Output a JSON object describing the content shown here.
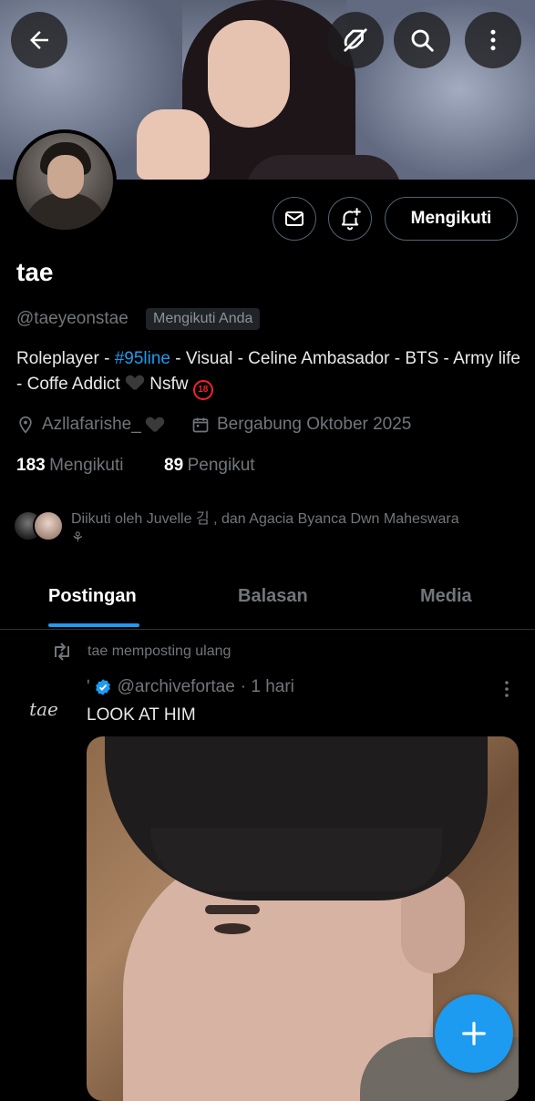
{
  "header": {
    "back_icon": "arrow-left-icon",
    "icons": [
      "tag-off-icon",
      "search-icon",
      "more-vertical-icon"
    ]
  },
  "profile": {
    "name": "tae",
    "handle": "@taeyeonstae",
    "follows_you": "Mengikuti Anda",
    "follow_button": "Mengikuti",
    "bio": {
      "part1": "Roleplayer - ",
      "hashtag": "#95line",
      "part2": " - Visual -  Celine Ambasador - BTS - Army life - Coffe Addict ",
      "part3": " Nsfw ",
      "r18": "18"
    },
    "location": "Azllafarishe_",
    "joined": "Bergabung Oktober 2025",
    "following_count": "183",
    "following_label": "Mengikuti",
    "followers_count": "89",
    "followers_label": "Pengikut",
    "followed_by": "Diikuti oleh Juvelle 김 , dan Agacia Byanca Dwn Maheswara",
    "followed_by_extra": "⚘"
  },
  "tabs": [
    "Postingan",
    "Balasan",
    "Media"
  ],
  "active_tab": "Postingan",
  "post": {
    "repost_label": "tae memposting ulang",
    "avatar_text": "tae",
    "author_prefix": "ʹ",
    "author_handle": "@archivefortae",
    "time": "· 1 hari",
    "text": "LOOK AT HIM"
  },
  "colors": {
    "accent": "#1d9bf0",
    "background": "#000000",
    "muted": "#71767b"
  }
}
